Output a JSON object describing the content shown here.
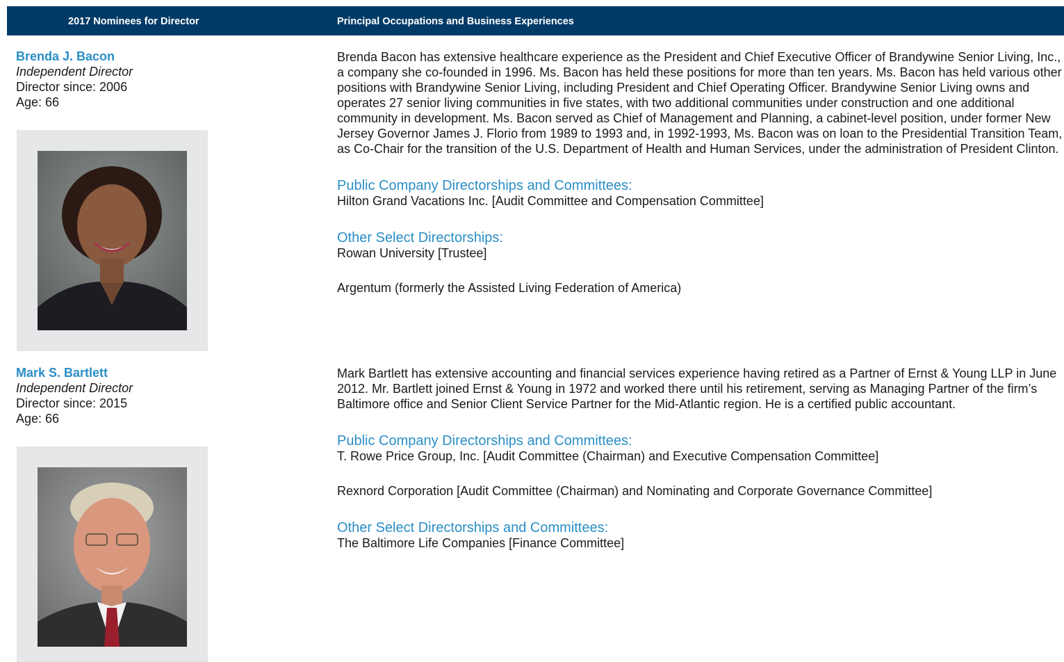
{
  "header": {
    "left_label": "2017 Nominees for Director",
    "right_label": "Principal Occupations and Business Experiences"
  },
  "directors": [
    {
      "name": "Brenda J. Bacon",
      "title": "Independent Director",
      "since": "Director since: 2006",
      "age": "Age: 66",
      "bio": "Brenda Bacon has extensive healthcare experience as the President and Chief Executive Officer of Brandywine Senior Living, Inc., a company she co-founded in 1996. Ms. Bacon has held these positions for more than ten years. Ms. Bacon has held various other positions with Brandywine Senior Living, including President and Chief Operating Officer. Brandywine Senior Living owns and operates 27 senior living communities in five states, with two additional communities under construction and one additional community in development. Ms. Bacon served as Chief of Management and Planning, a cabinet-level position, under former New Jersey Governor James J. Florio from 1989 to 1993 and, in 1992-1993, Ms. Bacon was on loan to the Presidential Transition Team, as Co-Chair for the transition of the U.S. Department of Health and Human Services, under the administration of President Clinton.",
      "section1_title": "Public Company Directorships and Committees:",
      "section1_items": [
        "Hilton Grand Vacations Inc. [Audit Committee and Compensation Committee]"
      ],
      "section2_title": "Other Select Directorships:",
      "section2_items": [
        "Rowan University [Trustee]",
        "Argentum (formerly the Assisted Living Federation of America)"
      ]
    },
    {
      "name": "Mark S. Bartlett",
      "title": "Independent Director",
      "since": "Director since: 2015",
      "age": "Age: 66",
      "bio": "Mark Bartlett has extensive accounting and financial services experience having retired as a Partner of Ernst & Young LLP in June 2012. Mr. Bartlett joined Ernst & Young in 1972 and worked there until his retirement, serving as Managing Partner of the firm’s Baltimore office and Senior Client Service Partner for the Mid-Atlantic region. He is a certified public accountant.",
      "section1_title": "Public Company Directorships and Committees:",
      "section1_items": [
        "T. Rowe Price Group, Inc. [Audit Committee (Chairman) and Executive Compensation Committee]",
        "Rexnord Corporation [Audit Committee (Chairman) and Nominating and Corporate Governance Committee]"
      ],
      "section2_title": "Other Select Directorships and Committees:",
      "section2_items": [
        "The Baltimore Life Companies [Finance Committee]"
      ]
    }
  ],
  "colors": {
    "header_bg": "#003a66",
    "accent": "#2a8ec6",
    "photo_frame": "#e6e7e9"
  }
}
